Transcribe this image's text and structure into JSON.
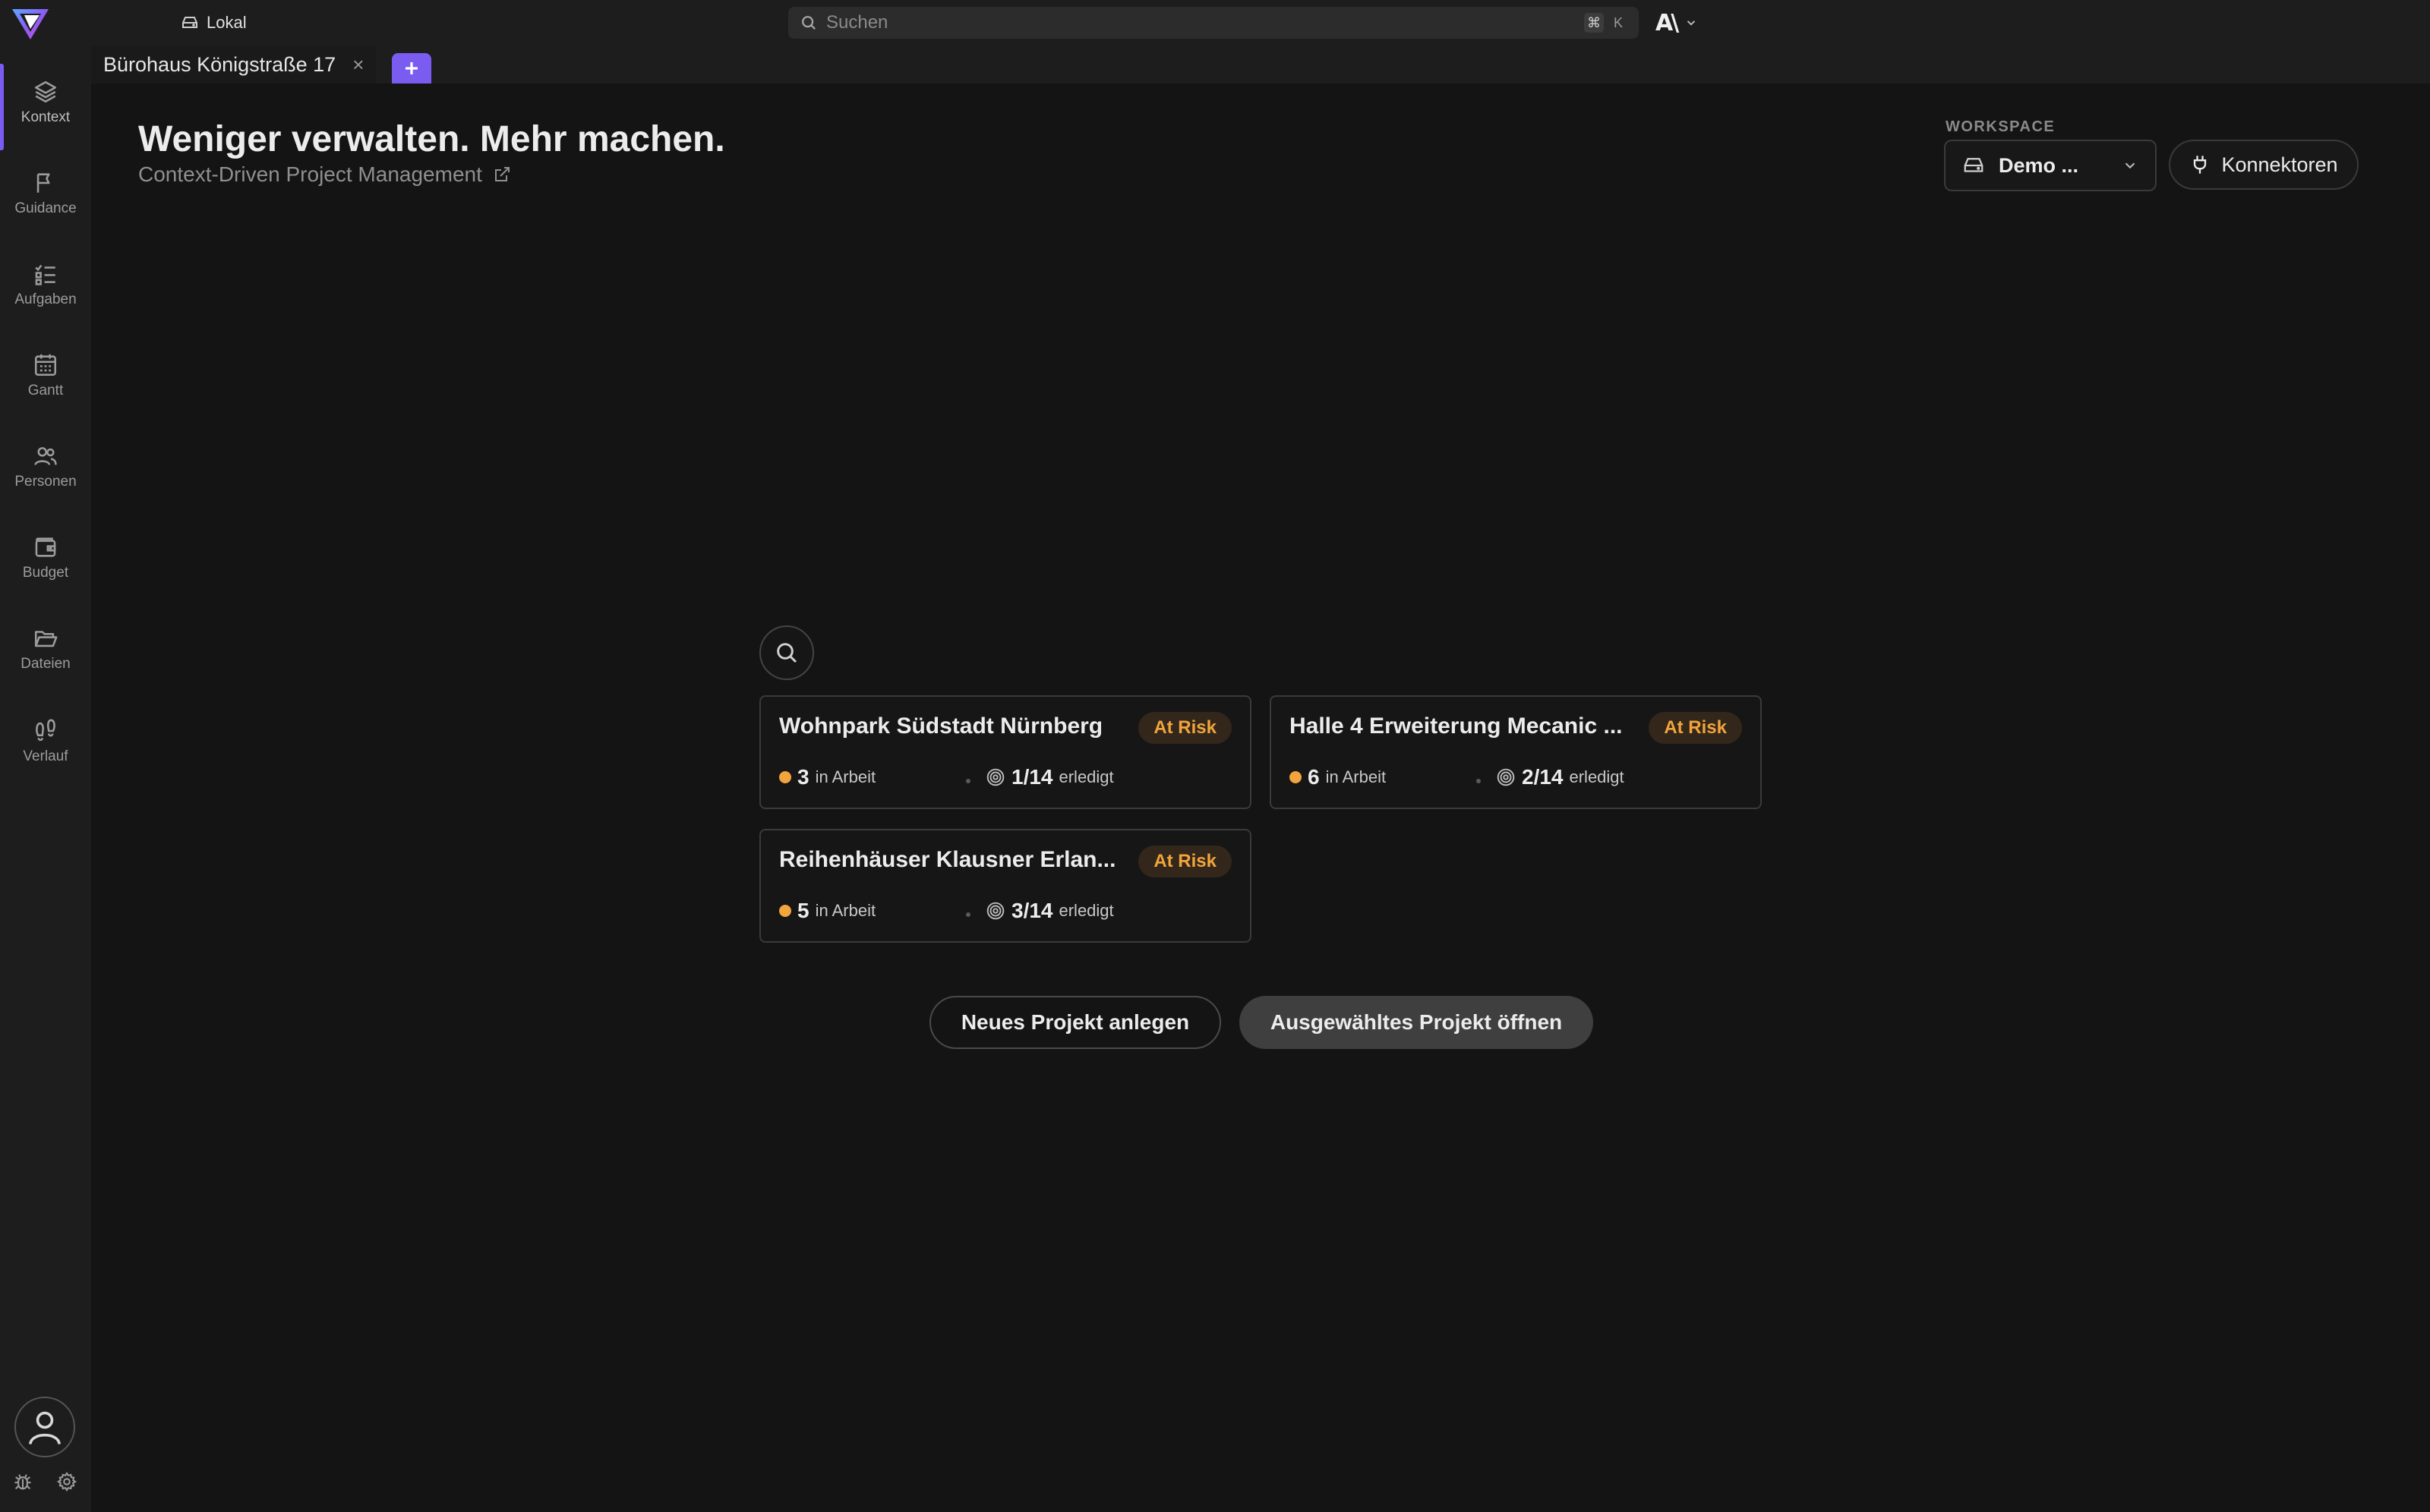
{
  "topbar": {
    "location_label": "Lokal",
    "search_placeholder": "Suchen",
    "shortcut_modifier": "⌘",
    "shortcut_key": "K"
  },
  "tabs": [
    {
      "label": "Bürohaus Königstraße 17",
      "close": "×"
    }
  ],
  "sidebar": {
    "items": [
      {
        "label": "Kontext",
        "icon": "layers-icon"
      },
      {
        "label": "Guidance",
        "icon": "flag-icon"
      },
      {
        "label": "Aufgaben",
        "icon": "list-check-icon"
      },
      {
        "label": "Gantt",
        "icon": "calendar-icon"
      },
      {
        "label": "Personen",
        "icon": "users-icon"
      },
      {
        "label": "Budget",
        "icon": "wallet-icon"
      },
      {
        "label": "Dateien",
        "icon": "folder-icon"
      },
      {
        "label": "Verlauf",
        "icon": "footprints-icon"
      }
    ]
  },
  "main": {
    "title": "Weniger verwalten. Mehr machen.",
    "subtitle": "Context-Driven Project Management"
  },
  "workspace": {
    "label": "WORKSPACE",
    "selected": "Demo ...",
    "connectors_label": "Konnektoren"
  },
  "projects": [
    {
      "title": "Wohnpark Südstadt Nürnberg",
      "status": "At Risk",
      "in_progress": "3",
      "in_progress_label": "in Arbeit",
      "done": "1/14",
      "done_label": "erledigt"
    },
    {
      "title": "Halle 4 Erweiterung Mecanic ...",
      "status": "At Risk",
      "in_progress": "6",
      "in_progress_label": "in Arbeit",
      "done": "2/14",
      "done_label": "erledigt"
    },
    {
      "title": "Reihenhäuser Klausner Erlan...",
      "status": "At Risk",
      "in_progress": "5",
      "in_progress_label": "in Arbeit",
      "done": "3/14",
      "done_label": "erledigt"
    }
  ],
  "actions": {
    "new_project": "Neues Projekt anlegen",
    "open_selected": "Ausgewähltes Projekt öffnen"
  },
  "colors": {
    "accent": "#7b5cf0",
    "warning": "#f1a53c",
    "background": "#141414",
    "sidebar": "#1d1d1d"
  }
}
